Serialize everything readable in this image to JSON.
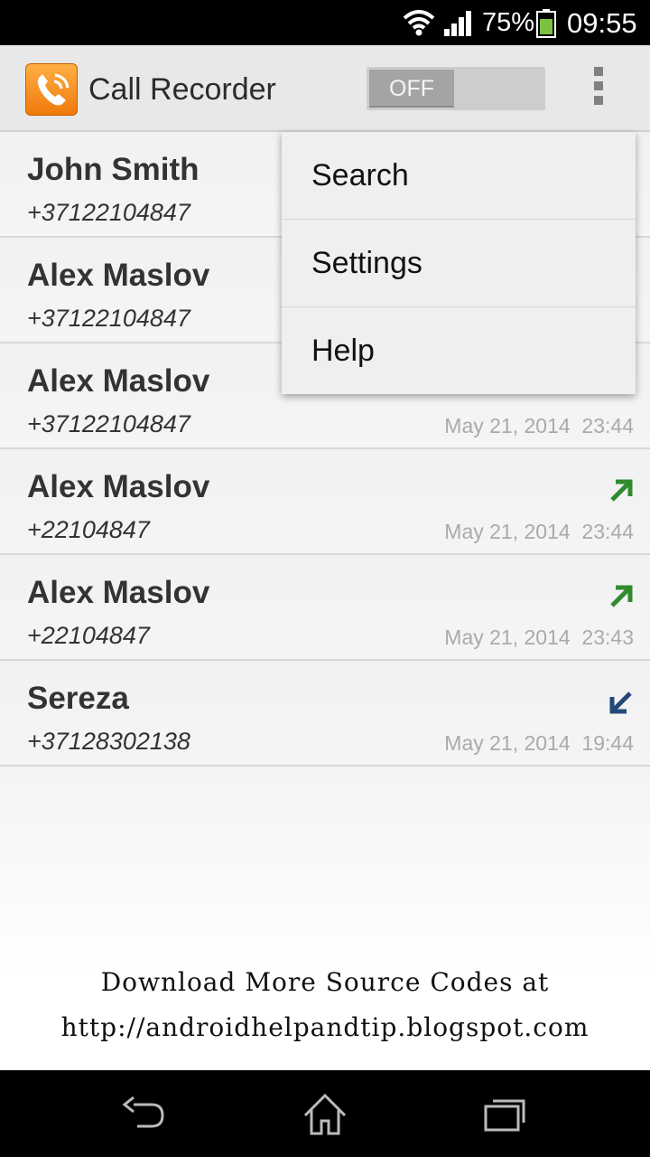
{
  "status_bar": {
    "battery_percent": "75%",
    "time": "09:55"
  },
  "action_bar": {
    "title": "Call Recorder",
    "toggle_label": "OFF"
  },
  "colors": {
    "outgoing": "#2e8b2e",
    "incoming": "#23487a",
    "app_icon": "#f28a1e"
  },
  "recordings": [
    {
      "name": "John Smith",
      "number": "+37122104847",
      "date": "",
      "direction": ""
    },
    {
      "name": "Alex Maslov",
      "number": "+37122104847",
      "date": "",
      "direction": ""
    },
    {
      "name": "Alex Maslov",
      "number": "+37122104847",
      "date": "May 21, 2014  23:44",
      "direction": ""
    },
    {
      "name": "Alex Maslov",
      "number": "+22104847",
      "date": "May 21, 2014  23:44",
      "direction": "outgoing-arrow-icon"
    },
    {
      "name": "Alex Maslov",
      "number": "+22104847",
      "date": "May 21, 2014  23:43",
      "direction": "outgoing-arrow-icon"
    },
    {
      "name": "Sereza",
      "number": "+37128302138",
      "date": "May 21, 2014  19:44",
      "direction": "incoming-arrow-icon"
    }
  ],
  "menu": {
    "items": [
      "Search",
      "Settings",
      "Help"
    ]
  },
  "promo": {
    "line1": "Download More Source Codes at",
    "line2": "http://androidhelpandtip.blogspot.com"
  }
}
